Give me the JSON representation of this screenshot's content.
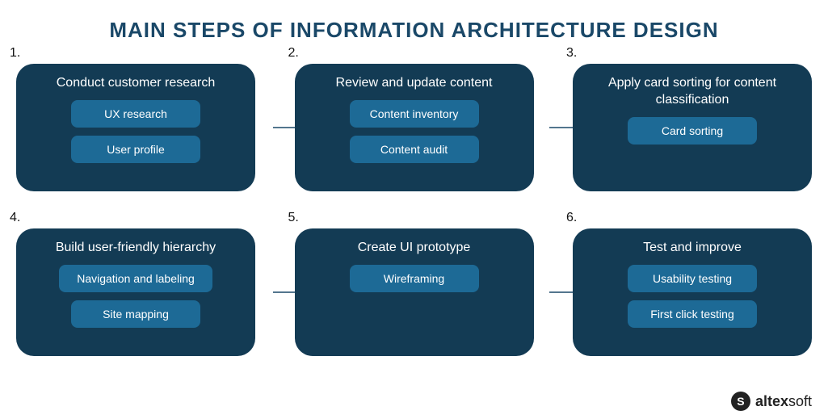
{
  "title": "MAIN STEPS OF INFORMATION ARCHITECTURE DESIGN",
  "steps": [
    {
      "num": "1.",
      "title": "Conduct customer research",
      "pills": [
        "UX research",
        "User profile"
      ]
    },
    {
      "num": "2.",
      "title": "Review and update content",
      "pills": [
        "Content inventory",
        "Content audit"
      ]
    },
    {
      "num": "3.",
      "title": "Apply card sorting for content classification",
      "pills": [
        "Card sorting"
      ],
      "titleTwoLine": true
    },
    {
      "num": "4.",
      "title": "Build user-friendly hierarchy",
      "pills": [
        "Navigation and labeling",
        "Site mapping"
      ]
    },
    {
      "num": "5.",
      "title": "Create UI prototype",
      "pills": [
        "Wireframing"
      ]
    },
    {
      "num": "6.",
      "title": "Test and improve",
      "pills": [
        "Usability testing",
        "First click testing"
      ]
    }
  ],
  "brand": {
    "mark": "S",
    "bold": "altex",
    "light": "soft"
  },
  "colors": {
    "cardBg": "#133b54",
    "pillBg": "#1d6a96",
    "titleColor": "#1a4868"
  }
}
